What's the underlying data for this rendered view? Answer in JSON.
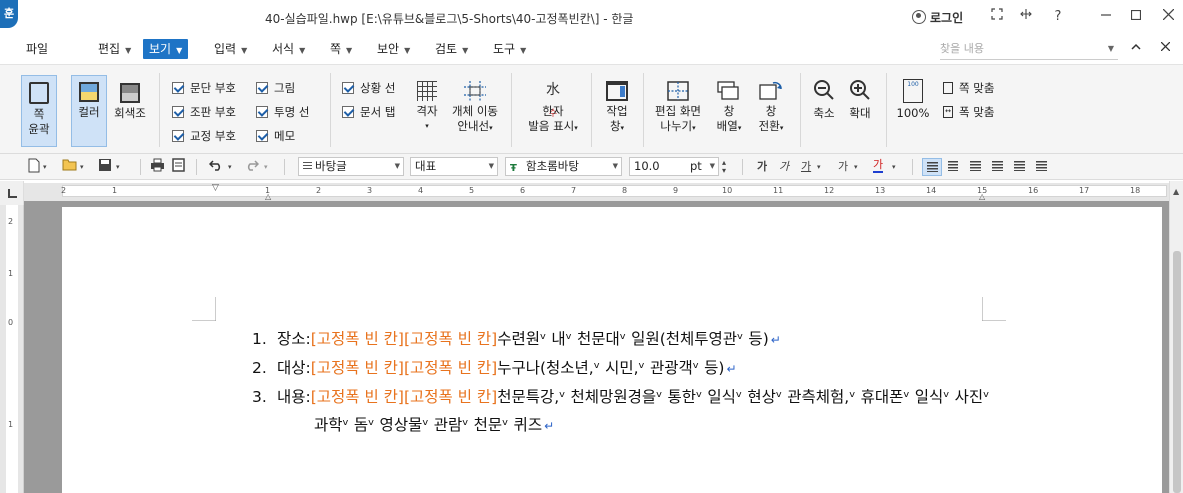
{
  "window": {
    "app_icon": "훈",
    "title": "40-실습파일.hwp [E:\\유튜브&블로그\\5-Shorts\\40-고정폭빈칸\\] - 한글",
    "login_label": "로그인",
    "controls": [
      "fullscreen-icon",
      "ribbon-toggle-icon",
      "help-icon",
      "minimize-icon",
      "maximize-icon",
      "close-icon"
    ],
    "help_label": "?"
  },
  "menu": {
    "file": "파일",
    "items": [
      "편집",
      "보기",
      "입력",
      "서식",
      "쪽",
      "보안",
      "검토",
      "도구"
    ],
    "active_index": 1,
    "search_placeholder": "찾을 내용"
  },
  "ribbon": {
    "zoom_outline": {
      "line1": "쪽",
      "line2": "윤곽"
    },
    "color": "컬러",
    "grayscale": "회색조",
    "checks_col1": [
      "문단 부호",
      "조판 부호",
      "교정 부호"
    ],
    "checks_col2": [
      "그림",
      "투명 선",
      "메모"
    ],
    "checks_col3": [
      "상황 선",
      "문서 탭"
    ],
    "grid": "격자",
    "object_move": {
      "line1": "개체 이동",
      "line2": "안내선"
    },
    "hanja": {
      "line1": "한자",
      "line2": "발음 표시"
    },
    "workspace": {
      "line1": "작업",
      "line2": "창"
    },
    "split": {
      "line1": "편집 화면",
      "line2": "나누기"
    },
    "arrange": {
      "line1": "창",
      "line2": "배열"
    },
    "switch": {
      "line1": "창",
      "line2": "전환"
    },
    "zoom_out": "축소",
    "zoom_in": "확대",
    "zoom_100": "100%",
    "fit_page": "쪽 맞춤",
    "fit_width": "폭 맞춤"
  },
  "format_toolbar": {
    "style": "바탕글",
    "script": "대표",
    "font": "함초롬바탕",
    "size": "10.0",
    "unit": "pt",
    "bold": "가",
    "italic": "가",
    "underline": "가",
    "strike": "가",
    "color": "가"
  },
  "ruler": {
    "numbers": [
      "2",
      "1",
      "1",
      "2",
      "3",
      "4",
      "5",
      "6",
      "7",
      "8",
      "9",
      "10",
      "11",
      "12",
      "13",
      "14",
      "15",
      "16",
      "17",
      "18"
    ],
    "vertical_numbers": [
      "2",
      "1",
      "0",
      "1"
    ]
  },
  "document": {
    "lines": [
      {
        "num": "1.",
        "label": "장소:",
        "blank1": "[고정폭 빈 칸]",
        "blank2": "[고정폭 빈 칸]",
        "rest": "수련원ᵛ 내ᵛ 천문대ᵛ 일원(천체투영관ᵛ 등)"
      },
      {
        "num": "2.",
        "label": "대상:",
        "blank1": "[고정폭 빈 칸]",
        "blank2": "[고정폭 빈 칸]",
        "rest": "누구나(청소년,ᵛ 시민,ᵛ 관광객ᵛ 등)"
      },
      {
        "num": "3.",
        "label": "내용:",
        "blank1": "[고정폭 빈 칸]",
        "blank2": "[고정폭 빈 칸]",
        "rest": "천문특강,ᵛ 천체망원경을ᵛ 통한ᵛ 일식ᵛ 현상ᵛ 관측체험,ᵛ 휴대폰ᵛ 일식ᵛ 사진ᵛ",
        "continuation": "과학ᵛ 돔ᵛ 영상물ᵛ 관람ᵛ 천문ᵛ 퀴즈"
      }
    ],
    "para_mark": "↵"
  },
  "colors": {
    "accent": "#1e74c6",
    "blank_text": "#e8731e",
    "para_mark": "#2c63c8"
  }
}
